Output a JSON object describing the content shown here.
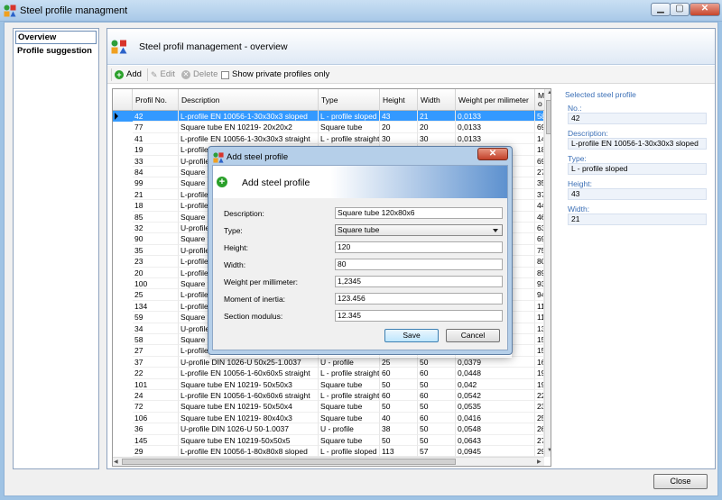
{
  "window": {
    "title": "Steel profile managment",
    "btn_min": "▁",
    "btn_max": "▢",
    "btn_close": "✕"
  },
  "nav": {
    "items": [
      {
        "label": "Overview"
      },
      {
        "label": "Profile suggestion"
      }
    ]
  },
  "main": {
    "title": "Steel profil management - overview"
  },
  "toolbar": {
    "add": "Add",
    "edit": "Edit",
    "delete": "Delete",
    "show_private": "Show private profiles only"
  },
  "grid": {
    "columns": [
      "Profil No.",
      "Description",
      "Type",
      "Height",
      "Width",
      "Weight per milimeter",
      "M o"
    ],
    "rows": [
      {
        "no": "42",
        "desc": "L-profile EN 10056-1-30x30x3 sloped",
        "type": "L - profile sloped",
        "h": "43",
        "w": "21",
        "wpm": "0,0133",
        "m": "58",
        "selected": true
      },
      {
        "no": "77",
        "desc": "Square tube EN 10219- 20x20x2",
        "type": "Square tube",
        "h": "20",
        "w": "20",
        "wpm": "0,0133",
        "m": "69"
      },
      {
        "no": "41",
        "desc": "L-profile EN 10056-1-30x30x3 straight",
        "type": "L - profile straight",
        "h": "30",
        "w": "30",
        "wpm": "0,0133",
        "m": "14"
      },
      {
        "no": "19",
        "desc": "L-profile",
        "type": "",
        "h": "",
        "w": "",
        "wpm": "",
        "m": "18"
      },
      {
        "no": "33",
        "desc": "U-profile",
        "type": "",
        "h": "",
        "w": "",
        "wpm": "",
        "m": "69"
      },
      {
        "no": "84",
        "desc": "Square tu",
        "type": "",
        "h": "",
        "w": "",
        "wpm": "",
        "m": "27"
      },
      {
        "no": "99",
        "desc": "Square tu",
        "type": "",
        "h": "",
        "w": "",
        "wpm": "",
        "m": "35"
      },
      {
        "no": "21",
        "desc": "L-profile",
        "type": "",
        "h": "",
        "w": "",
        "wpm": "",
        "m": "37"
      },
      {
        "no": "18",
        "desc": "L-profile",
        "type": "",
        "h": "",
        "w": "",
        "wpm": "",
        "m": "44"
      },
      {
        "no": "85",
        "desc": "Square tu",
        "type": "",
        "h": "",
        "w": "",
        "wpm": "",
        "m": "46"
      },
      {
        "no": "32",
        "desc": "U-profile",
        "type": "",
        "h": "",
        "w": "",
        "wpm": "",
        "m": "63"
      },
      {
        "no": "90",
        "desc": "Square tu",
        "type": "",
        "h": "",
        "w": "",
        "wpm": "",
        "m": "69"
      },
      {
        "no": "35",
        "desc": "U-profile",
        "type": "",
        "h": "",
        "w": "",
        "wpm": "",
        "m": "75"
      },
      {
        "no": "23",
        "desc": "L-profile",
        "type": "",
        "h": "",
        "w": "",
        "wpm": "",
        "m": "80"
      },
      {
        "no": "20",
        "desc": "L-profile",
        "type": "",
        "h": "",
        "w": "",
        "wpm": "",
        "m": "89"
      },
      {
        "no": "100",
        "desc": "Square tu",
        "type": "",
        "h": "",
        "w": "",
        "wpm": "",
        "m": "93"
      },
      {
        "no": "25",
        "desc": "L-profile",
        "type": "",
        "h": "",
        "w": "",
        "wpm": "",
        "m": "94"
      },
      {
        "no": "134",
        "desc": "L-profile",
        "type": "",
        "h": "",
        "w": "",
        "wpm": "",
        "m": "11"
      },
      {
        "no": "59",
        "desc": "Square tu",
        "type": "",
        "h": "",
        "w": "",
        "wpm": "",
        "m": "11"
      },
      {
        "no": "34",
        "desc": "U-profile",
        "type": "",
        "h": "",
        "w": "",
        "wpm": "",
        "m": "13"
      },
      {
        "no": "58",
        "desc": "Square tu",
        "type": "",
        "h": "",
        "w": "",
        "wpm": "",
        "m": "15"
      },
      {
        "no": "27",
        "desc": "L-profile",
        "type": "",
        "h": "",
        "w": "",
        "wpm": "",
        "m": "15"
      },
      {
        "no": "37",
        "desc": "U-profile DIN 1026-U 50x25-1.0037",
        "type": "U - profile",
        "h": "25",
        "w": "50",
        "wpm": "0,0379",
        "m": "16"
      },
      {
        "no": "22",
        "desc": "L-profile EN 10056-1-60x60x5 straight",
        "type": "L - profile straight",
        "h": "60",
        "w": "60",
        "wpm": "0,0448",
        "m": "19"
      },
      {
        "no": "101",
        "desc": "Square tube EN 10219- 50x50x3",
        "type": "Square tube",
        "h": "50",
        "w": "50",
        "wpm": "0,042",
        "m": "19"
      },
      {
        "no": "24",
        "desc": "L-profile EN 10056-1-60x60x6 straight",
        "type": "L - profile straight",
        "h": "60",
        "w": "60",
        "wpm": "0,0542",
        "m": "22"
      },
      {
        "no": "72",
        "desc": "Square tube EN 10219- 50x50x4",
        "type": "Square tube",
        "h": "50",
        "w": "50",
        "wpm": "0,0535",
        "m": "23"
      },
      {
        "no": "106",
        "desc": "Square tube EN 10219- 80x40x3",
        "type": "Square tube",
        "h": "40",
        "w": "60",
        "wpm": "0,0416",
        "m": "25"
      },
      {
        "no": "36",
        "desc": "U-profile DIN 1026-U 50-1.0037",
        "type": "U - profile",
        "h": "38",
        "w": "50",
        "wpm": "0,0548",
        "m": "26"
      },
      {
        "no": "145",
        "desc": "Square tube EN 10219-50x50x5",
        "type": "Square tube",
        "h": "50",
        "w": "50",
        "wpm": "0,0643",
        "m": "27"
      },
      {
        "no": "29",
        "desc": "L-profile EN 10056-1-80x80x8 sloped",
        "type": "L - profile sloped",
        "h": "113",
        "w": "57",
        "wpm": "0,0945",
        "m": "29"
      }
    ]
  },
  "detail": {
    "title": "Selected steel profile",
    "no_label": "No.:",
    "no_value": "42",
    "desc_label": "Description:",
    "desc_value": "L-profile EN 10056-1-30x30x3 sloped",
    "type_label": "Type:",
    "type_value": "L - profile sloped",
    "height_label": "Height:",
    "height_value": "43",
    "width_label": "Width:",
    "width_value": "21"
  },
  "close_button": "Close",
  "modal": {
    "title": "Add steel profile",
    "heading": "Add steel profile",
    "close": "✕",
    "fields": {
      "description": {
        "label": "Description:",
        "value": "Square tube 120x80x6"
      },
      "type": {
        "label": "Type:",
        "value": "Square tube"
      },
      "height": {
        "label": "Height:",
        "value": "120"
      },
      "width": {
        "label": "Width:",
        "value": "80"
      },
      "weight": {
        "label": "Weight per millimeter:",
        "value": "1,2345"
      },
      "inertia": {
        "label": "Moment of inertia:",
        "value": "123.456"
      },
      "modulus": {
        "label": "Section modulus:",
        "value": "12.345"
      }
    },
    "save": "Save",
    "cancel": "Cancel"
  }
}
